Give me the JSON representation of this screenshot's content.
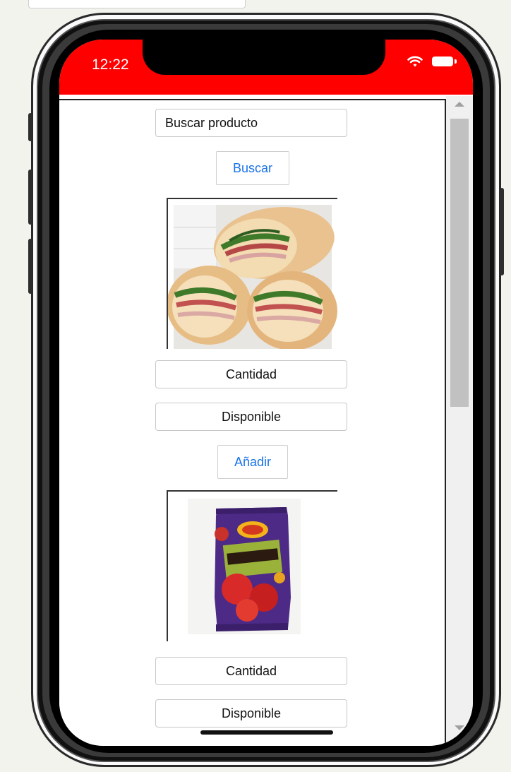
{
  "status_bar": {
    "time": "12:22",
    "color": "#ff0000"
  },
  "search": {
    "placeholder": "Buscar producto",
    "button_label": "Buscar"
  },
  "products": [
    {
      "quantity_label": "Cantidad",
      "available_label": "Disponible",
      "add_label": "Añadir"
    },
    {
      "quantity_label": "Cantidad",
      "available_label": "Disponible"
    }
  ],
  "icons": {
    "wifi": "wifi-icon",
    "battery": "battery-icon"
  },
  "colors": {
    "accent": "#1a73e8",
    "status_bar": "#ff0000"
  }
}
